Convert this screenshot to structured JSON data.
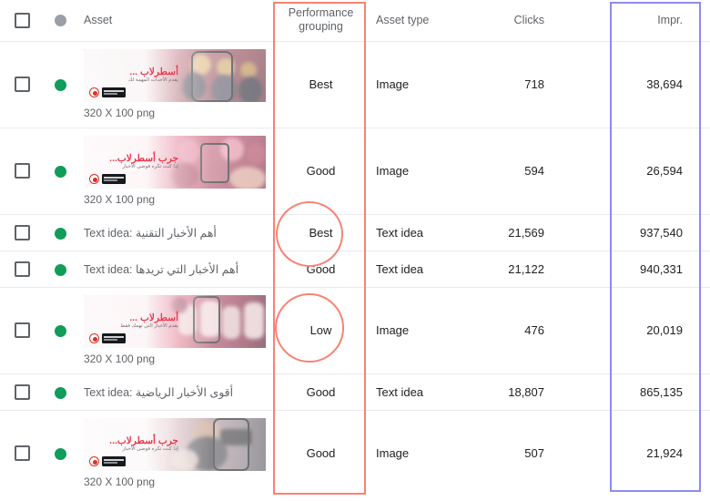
{
  "table": {
    "columns": [
      {
        "key": "checkbox",
        "label": "",
        "icon": "checkbox-icon"
      },
      {
        "key": "status",
        "label": "",
        "icon": "status-dot-icon"
      },
      {
        "key": "asset",
        "label": "Asset"
      },
      {
        "key": "performance_grouping",
        "label_line1": "Performance",
        "label_line2": "grouping"
      },
      {
        "key": "asset_type",
        "label": "Asset type"
      },
      {
        "key": "clicks",
        "label": "Clicks"
      },
      {
        "key": "impressions",
        "label": "Impr."
      }
    ],
    "rows": [
      {
        "type": "image",
        "status": "green",
        "thumb_title": "أسطرلاب ...",
        "thumb_sub": "يقدم الأحداث المهمة لك",
        "dimensions": "320 X 100 png",
        "performance_grouping": "Best",
        "asset_type": "Image",
        "clicks": "718",
        "impressions": "38,694"
      },
      {
        "type": "image",
        "status": "green",
        "thumb_title": "جرب أسطرلاب...",
        "thumb_sub": "إذا كنت تكره فوضى الأخبار",
        "dimensions": "320 X 100 png",
        "performance_grouping": "Good",
        "asset_type": "Image",
        "clicks": "594",
        "impressions": "26,594"
      },
      {
        "type": "text",
        "status": "green",
        "label_prefix": "Text idea:",
        "label_text": "أهم الأخبار التقنية",
        "performance_grouping": "Best",
        "asset_type": "Text idea",
        "clicks": "21,569",
        "impressions": "937,540"
      },
      {
        "type": "text",
        "status": "green",
        "label_prefix": "Text idea:",
        "label_text": "أهم الأخبار التي تريدها",
        "performance_grouping": "Good",
        "asset_type": "Text idea",
        "clicks": "21,122",
        "impressions": "940,331"
      },
      {
        "type": "image",
        "status": "green",
        "thumb_title": "أسطرلاب ...",
        "thumb_sub": "يقدم الأخبار التي تهمك فقط",
        "dimensions": "320 X 100 png",
        "performance_grouping": "Low",
        "asset_type": "Image",
        "clicks": "476",
        "impressions": "20,019"
      },
      {
        "type": "text",
        "status": "green",
        "label_prefix": "Text idea:",
        "label_text": "أقوى الأخبار الرياضية",
        "performance_grouping": "Good",
        "asset_type": "Text idea",
        "clicks": "18,807",
        "impressions": "865,135"
      },
      {
        "type": "image",
        "status": "green",
        "thumb_title": "جرب أسطرلاب...",
        "thumb_sub": "إذا كنت تكره فوضى الأخبار",
        "dimensions": "320 X 100 png",
        "performance_grouping": "Good",
        "asset_type": "Image",
        "clicks": "507",
        "impressions": "21,924"
      }
    ]
  },
  "annotations": {
    "performance_column_highlight_color": "#f98274",
    "impressions_column_highlight_color": "#8c8cf0",
    "circled_values": [
      "Best",
      "Low"
    ]
  },
  "colors": {
    "status_green": "#0f9d58",
    "status_grey": "#9aa0a6",
    "header_text": "#5f6368",
    "body_text": "#202124",
    "row_divider": "#e8eaed"
  }
}
